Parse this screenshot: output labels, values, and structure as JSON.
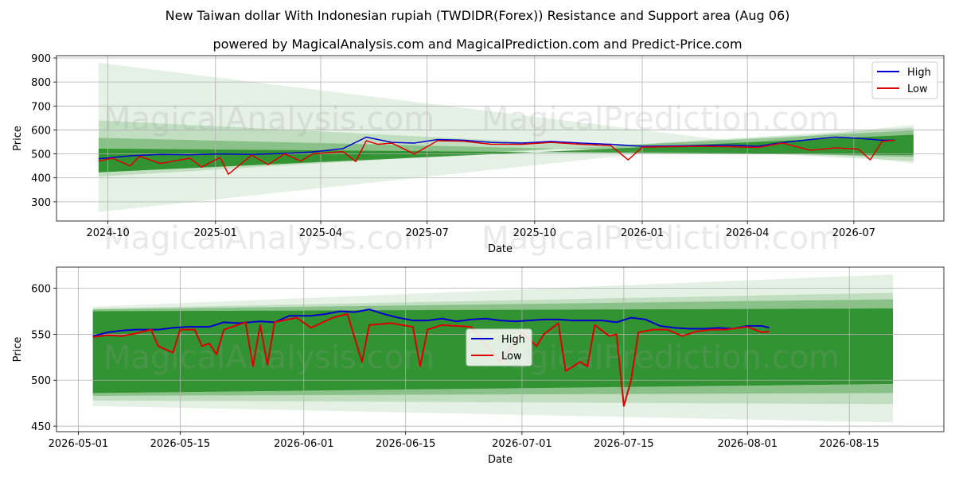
{
  "title": "New Taiwan dollar With Indonesian rupiah (TWDIDR(Forex)) Resistance and Support area (Aug 06)",
  "subtitle": "powered by MagicalAnalysis.com and MagicalPrediction.com and Predict-Price.com",
  "watermarks": [
    "MagicalAnalysis.com",
    "MagicalPrediction.com"
  ],
  "colors": {
    "high": "#0000cc",
    "low": "#dd0000",
    "band": "#228b22"
  },
  "chart_data": [
    {
      "type": "line",
      "xlabel": "Date",
      "ylabel": "Price",
      "xlim": [
        "2024-08-18",
        "2026-09-16"
      ],
      "ylim": [
        220,
        910
      ],
      "grid": true,
      "legend": "top-right",
      "x_ticks": [
        "2024-10",
        "2025-01",
        "2025-04",
        "2025-07",
        "2025-10",
        "2026-01",
        "2026-04",
        "2026-07"
      ],
      "x_tick_dates": [
        "2024-10-01",
        "2025-01-01",
        "2025-04-01",
        "2025-07-01",
        "2025-10-01",
        "2026-01-01",
        "2026-04-01",
        "2026-07-01"
      ],
      "y_ticks": [
        300,
        400,
        500,
        600,
        700,
        800,
        900
      ],
      "bands": {
        "start": "2024-09-23",
        "end": "2026-08-21",
        "dark": [
          [
            423,
            522
          ],
          [
            580,
            495
          ]
        ],
        "mid": [
          [
            423,
            567
          ],
          [
            598,
            487
          ]
        ],
        "light": [
          [
            405,
            640
          ],
          [
            610,
            470
          ]
        ],
        "faint": [
          [
            258,
            880
          ],
          [
            622,
            460
          ]
        ]
      },
      "series": [
        {
          "name": "High",
          "x": [
            "2024-09-23",
            "2024-10-20",
            "2024-11-15",
            "2024-12-10",
            "2025-01-05",
            "2025-02-01",
            "2025-03-01",
            "2025-03-25",
            "2025-04-20",
            "2025-05-10",
            "2025-06-01",
            "2025-06-20",
            "2025-07-10",
            "2025-08-01",
            "2025-08-25",
            "2025-09-20",
            "2025-10-15",
            "2025-11-10",
            "2025-12-05",
            "2026-01-01",
            "2026-01-25",
            "2026-02-20",
            "2026-03-15",
            "2026-04-10",
            "2026-05-01",
            "2026-05-25",
            "2026-06-15",
            "2026-07-05",
            "2026-07-25",
            "2026-08-05"
          ],
          "values": [
            480,
            492,
            498,
            496,
            500,
            498,
            502,
            508,
            522,
            570,
            548,
            545,
            560,
            557,
            548,
            545,
            552,
            545,
            540,
            532,
            533,
            535,
            537,
            532,
            547,
            560,
            570,
            565,
            557,
            557
          ]
        },
        {
          "name": "Low",
          "x": [
            "2024-09-23",
            "2024-10-05",
            "2024-10-20",
            "2024-10-28",
            "2024-11-15",
            "2024-12-10",
            "2024-12-20",
            "2025-01-05",
            "2025-01-12",
            "2025-02-01",
            "2025-02-15",
            "2025-03-01",
            "2025-03-15",
            "2025-03-25",
            "2025-04-20",
            "2025-05-01",
            "2025-05-10",
            "2025-05-20",
            "2025-06-01",
            "2025-06-20",
            "2025-07-10",
            "2025-08-01",
            "2025-08-25",
            "2025-09-20",
            "2025-10-15",
            "2025-11-10",
            "2025-12-05",
            "2025-12-20",
            "2026-01-01",
            "2026-01-25",
            "2026-02-20",
            "2026-03-15",
            "2026-04-10",
            "2026-05-01",
            "2026-05-25",
            "2026-06-15",
            "2026-07-05",
            "2026-07-15",
            "2026-07-25",
            "2026-08-05"
          ],
          "values": [
            470,
            482,
            450,
            490,
            460,
            482,
            445,
            485,
            415,
            495,
            455,
            500,
            470,
            500,
            510,
            468,
            555,
            540,
            545,
            500,
            555,
            553,
            540,
            540,
            548,
            540,
            535,
            475,
            528,
            530,
            532,
            530,
            527,
            545,
            515,
            525,
            520,
            475,
            552,
            557
          ]
        }
      ]
    },
    {
      "type": "line",
      "xlabel": "Date",
      "ylabel": "Price",
      "xlim": [
        "2026-04-28",
        "2026-08-28"
      ],
      "ylim": [
        444,
        623
      ],
      "grid": true,
      "legend": "center",
      "x_ticks": [
        "2026-05-01",
        "2026-05-15",
        "2026-06-01",
        "2026-06-15",
        "2026-07-01",
        "2026-07-15",
        "2026-08-01",
        "2026-08-15"
      ],
      "y_ticks": [
        450,
        500,
        550,
        600
      ],
      "bands": {
        "start": "2026-05-03",
        "end": "2026-08-21",
        "dark": [
          [
            486,
            575
          ],
          [
            496,
            578
          ]
        ],
        "mid": [
          [
            483,
            577
          ],
          [
            486,
            588
          ]
        ],
        "light": [
          [
            478,
            578
          ],
          [
            474,
            595
          ]
        ],
        "faint": [
          [
            472,
            580
          ],
          [
            454,
            615
          ]
        ]
      },
      "series": [
        {
          "name": "High",
          "x": [
            "2026-05-03",
            "2026-05-05",
            "2026-05-07",
            "2026-05-09",
            "2026-05-12",
            "2026-05-14",
            "2026-05-16",
            "2026-05-19",
            "2026-05-21",
            "2026-05-23",
            "2026-05-26",
            "2026-05-28",
            "2026-05-30",
            "2026-06-02",
            "2026-06-04",
            "2026-06-06",
            "2026-06-08",
            "2026-06-10",
            "2026-06-12",
            "2026-06-14",
            "2026-06-16",
            "2026-06-18",
            "2026-06-20",
            "2026-06-22",
            "2026-06-24",
            "2026-06-26",
            "2026-06-28",
            "2026-06-30",
            "2026-07-02",
            "2026-07-04",
            "2026-07-06",
            "2026-07-08",
            "2026-07-10",
            "2026-07-12",
            "2026-07-14",
            "2026-07-16",
            "2026-07-18",
            "2026-07-20",
            "2026-07-22",
            "2026-07-24",
            "2026-07-26",
            "2026-07-28",
            "2026-07-30",
            "2026-08-01",
            "2026-08-03",
            "2026-08-04"
          ],
          "values": [
            548,
            552,
            554,
            555,
            555,
            557,
            558,
            558,
            563,
            562,
            564,
            563,
            570,
            570,
            572,
            575,
            574,
            577,
            572,
            568,
            565,
            565,
            567,
            564,
            566,
            567,
            565,
            564,
            565,
            566,
            566,
            565,
            565,
            565,
            563,
            568,
            566,
            559,
            557,
            556,
            556,
            557,
            556,
            559,
            559,
            557
          ]
        },
        {
          "name": "Low",
          "x": [
            "2026-05-03",
            "2026-05-05",
            "2026-05-07",
            "2026-05-09",
            "2026-05-11",
            "2026-05-12",
            "2026-05-14",
            "2026-05-15",
            "2026-05-17",
            "2026-05-18",
            "2026-05-19",
            "2026-05-20",
            "2026-05-21",
            "2026-05-24",
            "2026-05-25",
            "2026-05-26",
            "2026-05-27",
            "2026-05-28",
            "2026-05-31",
            "2026-06-02",
            "2026-06-05",
            "2026-06-07",
            "2026-06-09",
            "2026-06-10",
            "2026-06-13",
            "2026-06-16",
            "2026-06-17",
            "2026-06-18",
            "2026-06-20",
            "2026-06-24",
            "2026-06-28",
            "2026-07-01",
            "2026-07-03",
            "2026-07-04",
            "2026-07-06",
            "2026-07-07",
            "2026-07-09",
            "2026-07-10",
            "2026-07-11",
            "2026-07-13",
            "2026-07-14",
            "2026-07-15",
            "2026-07-16",
            "2026-07-17",
            "2026-07-19",
            "2026-07-21",
            "2026-07-23",
            "2026-07-25",
            "2026-07-27",
            "2026-07-29",
            "2026-08-01",
            "2026-08-03",
            "2026-08-04"
          ],
          "values": [
            547,
            549,
            548,
            551,
            555,
            537,
            530,
            555,
            555,
            537,
            540,
            528,
            555,
            563,
            515,
            560,
            517,
            563,
            568,
            557,
            568,
            572,
            520,
            560,
            562,
            558,
            515,
            555,
            560,
            558,
            520,
            552,
            537,
            550,
            562,
            510,
            520,
            515,
            560,
            548,
            550,
            472,
            500,
            552,
            555,
            555,
            548,
            553,
            555,
            555,
            558,
            552,
            553
          ]
        }
      ]
    }
  ]
}
